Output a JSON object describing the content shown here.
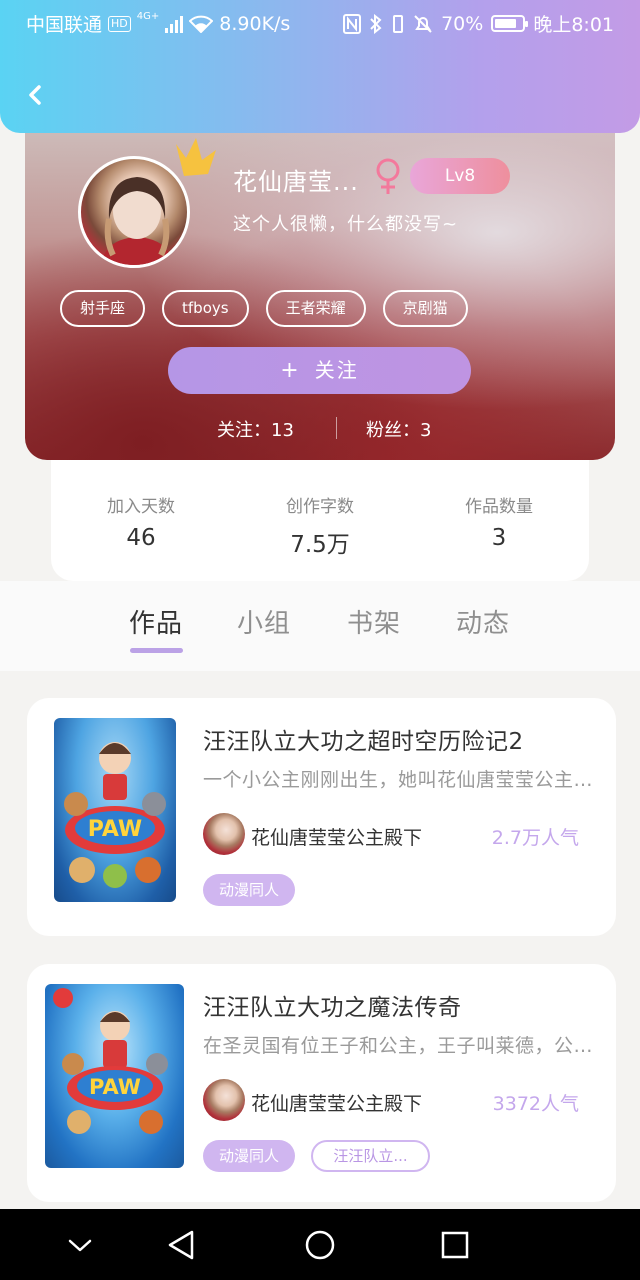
{
  "status_bar": {
    "carrier": "中国联通",
    "hd_badge": "HD",
    "network": "4G+",
    "speed": "8.90K/s",
    "battery": "70%",
    "time": "晚上8:01"
  },
  "profile": {
    "nickname": "花仙唐莹...",
    "level": "Lv8",
    "bio": "这个人很懒，什么都没写~",
    "tags": [
      "射手座",
      "tfboys",
      "王者荣耀",
      "京剧猫"
    ],
    "follow_icon": "+",
    "follow_label": "关注",
    "following": "关注：13",
    "fans": "粉丝：3"
  },
  "stats": [
    {
      "label": "加入天数",
      "value": "46"
    },
    {
      "label": "创作字数",
      "value": "7.5万"
    },
    {
      "label": "作品数量",
      "value": "3"
    }
  ],
  "tabs": [
    "作品",
    "小组",
    "书架",
    "动态"
  ],
  "works": [
    {
      "title": "汪汪队立大功之超时空历险记2",
      "desc": "一个小公主刚刚出生，她叫花仙唐莹莹公主殿下",
      "author": "花仙唐莹莹公主殿下",
      "popularity": "2.7万人气",
      "chips": [
        "动漫同人"
      ]
    },
    {
      "title": "汪汪队立大功之魔法传奇",
      "desc": "在圣灵国有位王子和公主，王子叫莱德，公主叫",
      "author": "花仙唐莹莹公主殿下",
      "popularity": "3372人气",
      "chips": [
        "动漫同人",
        "汪汪队立..."
      ]
    }
  ],
  "colors": {
    "accent": "#bba2e6",
    "header_gradient_start": "#5ad3f3",
    "header_gradient_end": "#c39be6",
    "level_badge": "#ee8f9d"
  }
}
